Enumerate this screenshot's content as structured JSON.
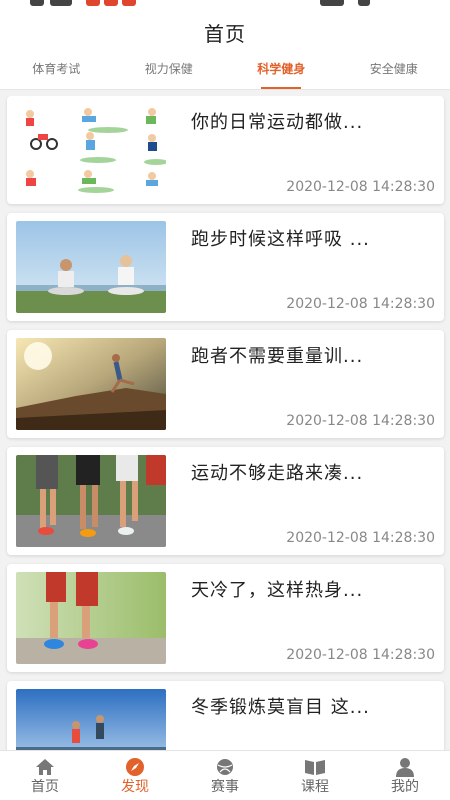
{
  "header": {
    "title": "首页"
  },
  "tabs": [
    {
      "label": "体育考试",
      "active": false
    },
    {
      "label": "视力保健",
      "active": false
    },
    {
      "label": "科学健身",
      "active": true
    },
    {
      "label": "安全健康",
      "active": false
    }
  ],
  "articles": [
    {
      "title": "你的日常运动都做...",
      "date": "2020-12-08 14:28:30",
      "thumb": "sports-cartoon"
    },
    {
      "title": "跑步时候这样呼吸 ...",
      "date": "2020-12-08 14:28:30",
      "thumb": "yoga-couple"
    },
    {
      "title": "跑者不需要重量训...",
      "date": "2020-12-08 14:28:30",
      "thumb": "sunset-runner"
    },
    {
      "title": "运动不够走路来凑...",
      "date": "2020-12-08 14:28:30",
      "thumb": "race-legs"
    },
    {
      "title": "天冷了，这样热身...",
      "date": "2020-12-08 14:28:30",
      "thumb": "knee-pain"
    },
    {
      "title": "冬季锻炼莫盲目 这...",
      "date": "",
      "thumb": "sky-runners"
    }
  ],
  "tabbar": [
    {
      "label": "首页",
      "icon": "home-icon",
      "active": false
    },
    {
      "label": "发现",
      "icon": "compass-icon",
      "active": true
    },
    {
      "label": "赛事",
      "icon": "ball-icon",
      "active": false
    },
    {
      "label": "课程",
      "icon": "book-icon",
      "active": false
    },
    {
      "label": "我的",
      "icon": "person-icon",
      "active": false
    }
  ],
  "colors": {
    "accent": "#e2622c",
    "background": "#f2f2f2",
    "muted": "#888888"
  }
}
